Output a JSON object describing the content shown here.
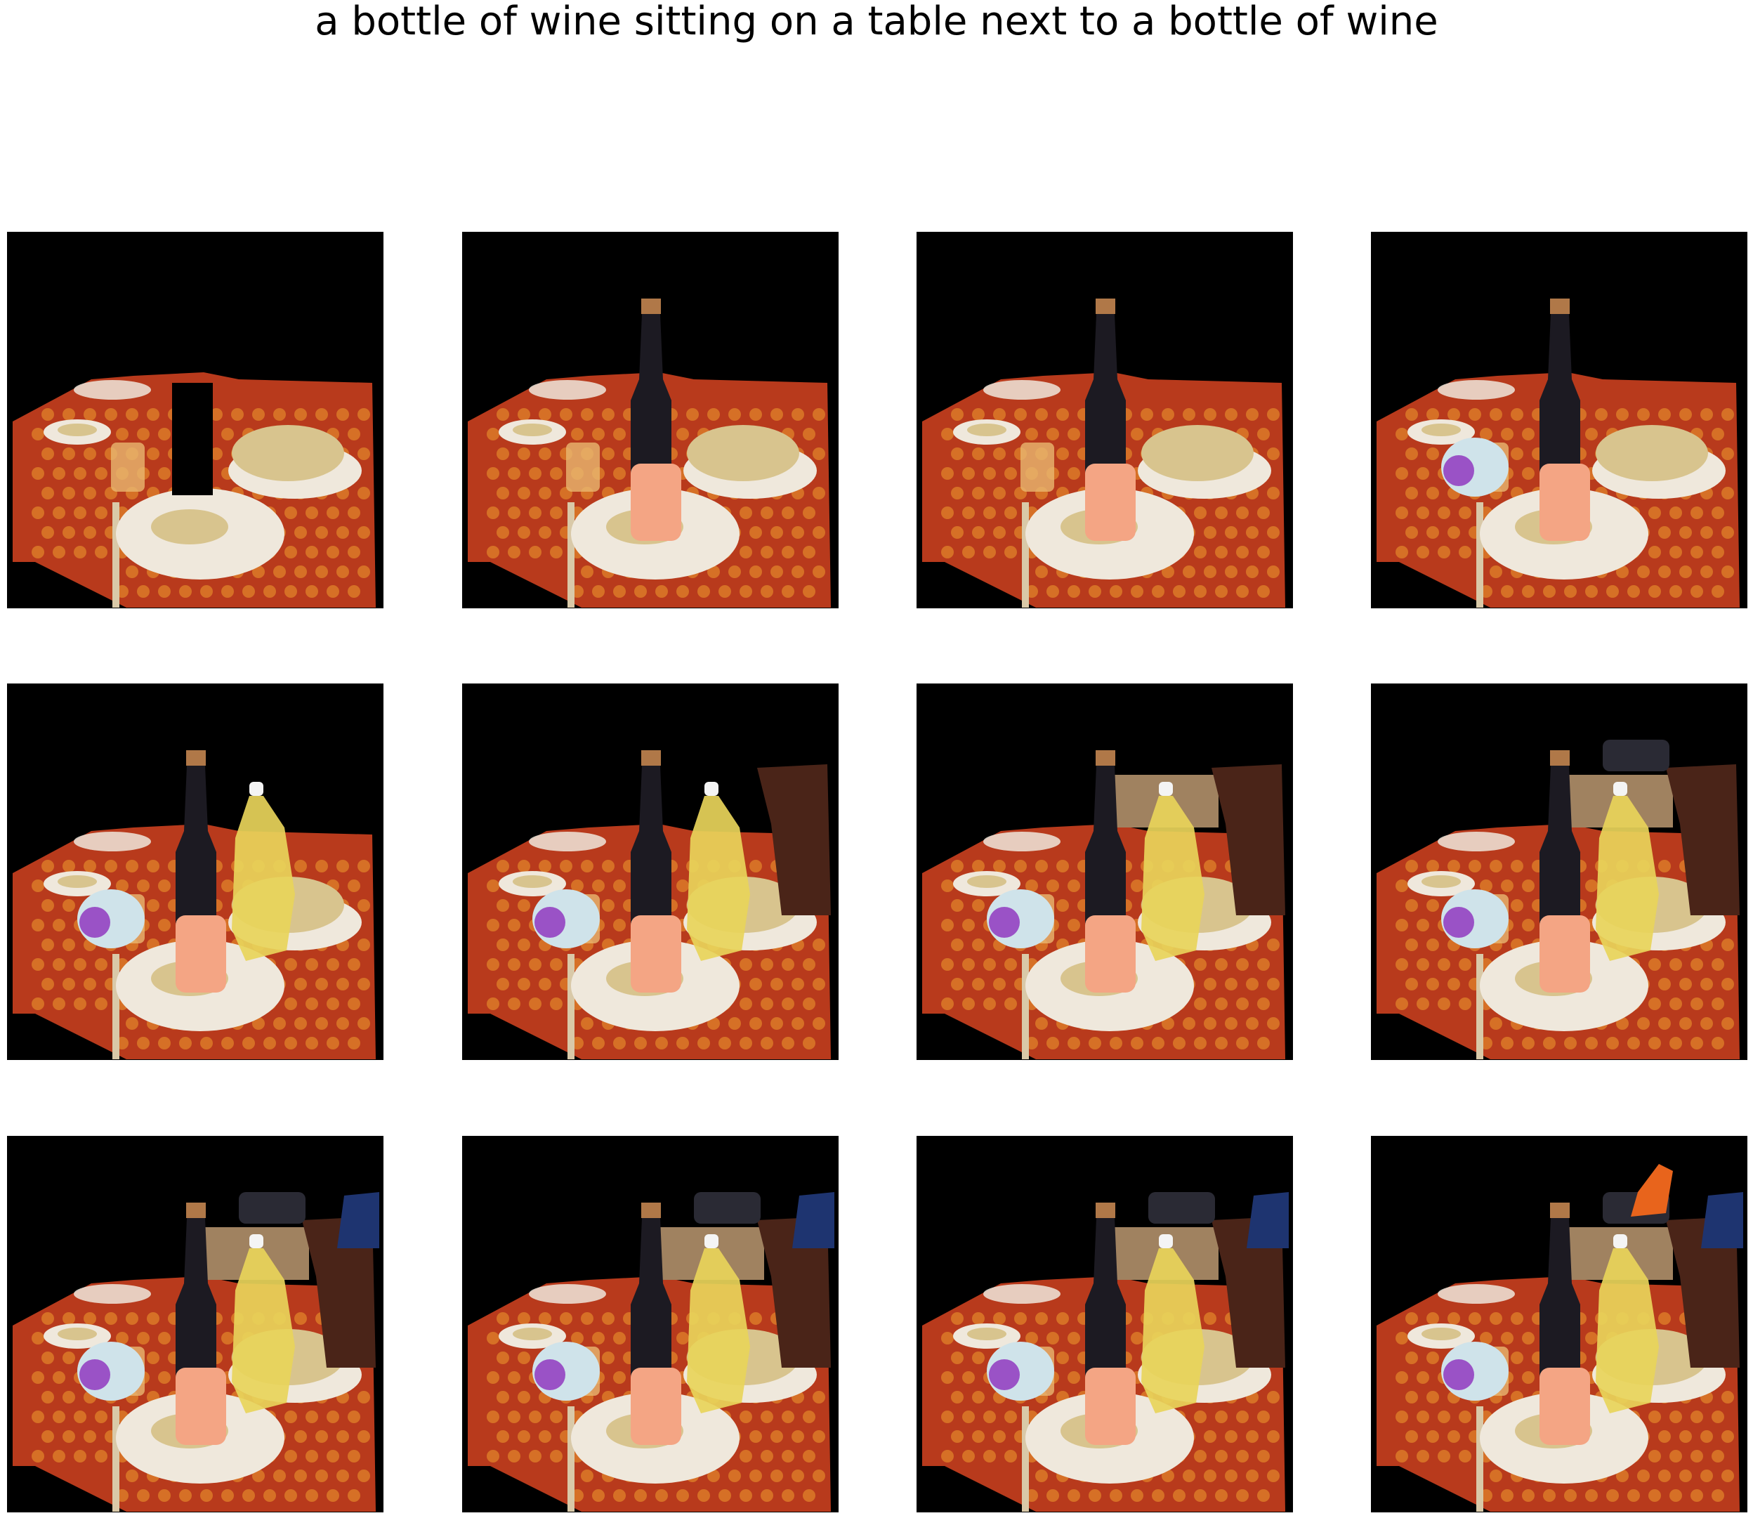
{
  "title": "a bottle of wine sitting on a table next to a bottle of wine",
  "frames": [
    {
      "wine_bottle": false,
      "label_bottle": false,
      "water_bottle": false,
      "soda_bottle": false,
      "chair": false,
      "box": false,
      "cushion": false,
      "blue_chair": false,
      "orange_chair": false
    },
    {
      "wine_bottle": true,
      "label_bottle": true,
      "water_bottle": false,
      "soda_bottle": false,
      "chair": false,
      "box": false,
      "cushion": false,
      "blue_chair": false,
      "orange_chair": false
    },
    {
      "wine_bottle": true,
      "label_bottle": true,
      "water_bottle": false,
      "soda_bottle": false,
      "chair": false,
      "box": false,
      "cushion": false,
      "blue_chair": false,
      "orange_chair": false
    },
    {
      "wine_bottle": true,
      "label_bottle": true,
      "water_bottle": true,
      "soda_bottle": false,
      "chair": false,
      "box": false,
      "cushion": false,
      "blue_chair": false,
      "orange_chair": false
    },
    {
      "wine_bottle": true,
      "label_bottle": true,
      "water_bottle": true,
      "soda_bottle": true,
      "chair": false,
      "box": false,
      "cushion": false,
      "blue_chair": false,
      "orange_chair": false
    },
    {
      "wine_bottle": true,
      "label_bottle": true,
      "water_bottle": true,
      "soda_bottle": true,
      "chair": true,
      "box": false,
      "cushion": false,
      "blue_chair": false,
      "orange_chair": false
    },
    {
      "wine_bottle": true,
      "label_bottle": true,
      "water_bottle": true,
      "soda_bottle": true,
      "chair": true,
      "box": true,
      "cushion": false,
      "blue_chair": false,
      "orange_chair": false
    },
    {
      "wine_bottle": true,
      "label_bottle": true,
      "water_bottle": true,
      "soda_bottle": true,
      "chair": true,
      "box": true,
      "cushion": true,
      "blue_chair": false,
      "orange_chair": false
    },
    {
      "wine_bottle": true,
      "label_bottle": true,
      "water_bottle": true,
      "soda_bottle": true,
      "chair": true,
      "box": true,
      "cushion": true,
      "blue_chair": true,
      "orange_chair": false
    },
    {
      "wine_bottle": true,
      "label_bottle": true,
      "water_bottle": true,
      "soda_bottle": true,
      "chair": true,
      "box": true,
      "cushion": true,
      "blue_chair": true,
      "orange_chair": false
    },
    {
      "wine_bottle": true,
      "label_bottle": true,
      "water_bottle": true,
      "soda_bottle": true,
      "chair": true,
      "box": true,
      "cushion": true,
      "blue_chair": true,
      "orange_chair": false
    },
    {
      "wine_bottle": true,
      "label_bottle": true,
      "water_bottle": true,
      "soda_bottle": true,
      "chair": true,
      "box": true,
      "cushion": true,
      "blue_chair": true,
      "orange_chair": true
    }
  ],
  "colors": {
    "background": "#000000",
    "table": "#b83a1c",
    "table_dots": "#e0832a",
    "plate": "#efe8dc",
    "food": "#d8c48e",
    "wine_bottle": "#1c1a22",
    "cork": "#b07848",
    "label_bottle": "#f4a584",
    "water_bottle": "#cfe3ea",
    "water_label": "#9a52c6",
    "soda_bottle": "#e8d45a",
    "chair": "#4a2418",
    "box": "#a08260",
    "cushion": "#2a2a34",
    "blue_chair": "#1e3470",
    "orange_chair": "#e8641c"
  }
}
